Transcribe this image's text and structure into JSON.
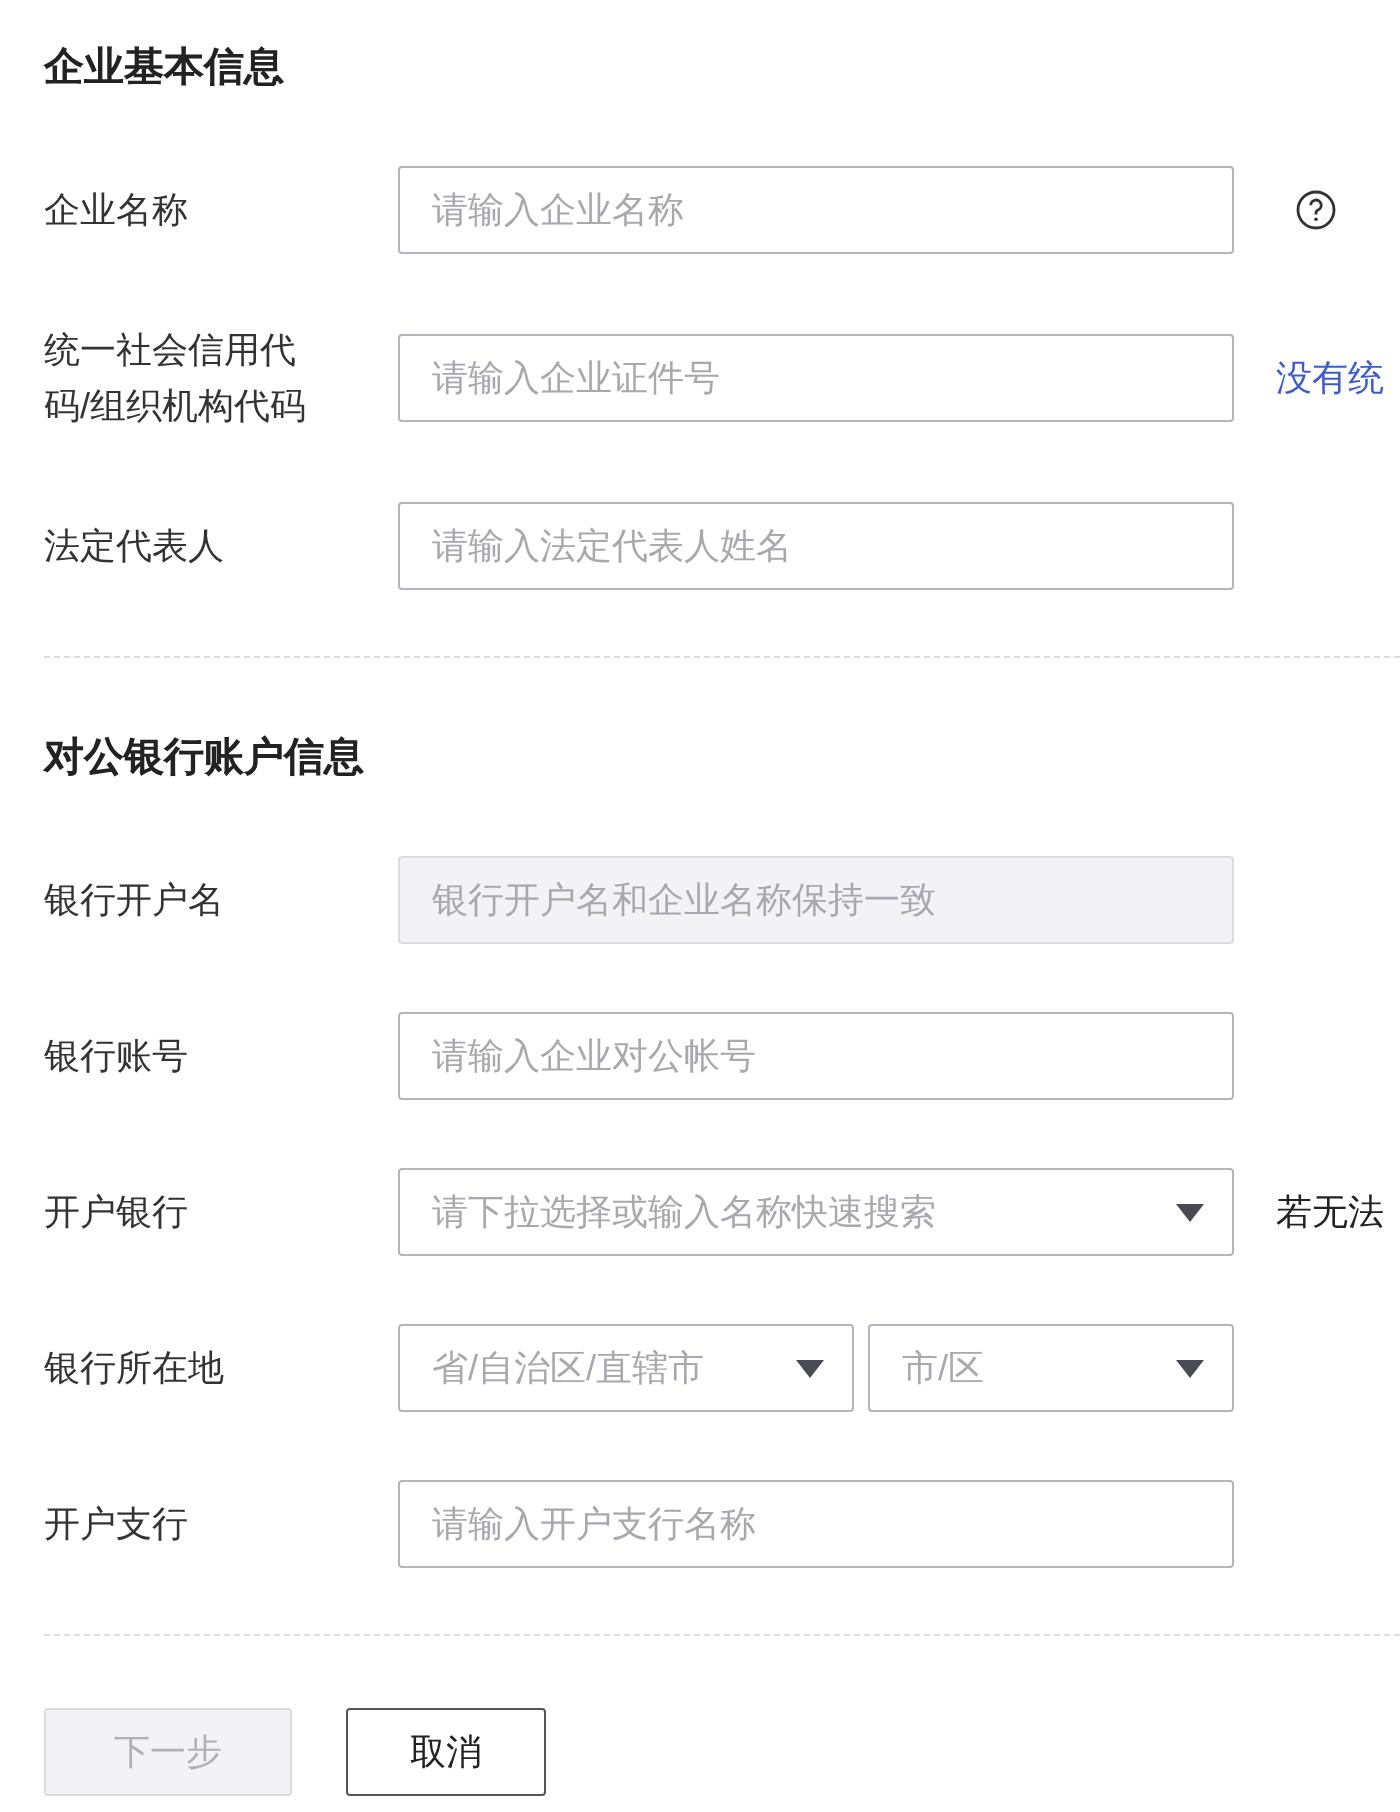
{
  "sections": [
    {
      "title": "企业基本信息",
      "fields": [
        {
          "label": "企业名称",
          "kind": "input",
          "placeholder": "请输入企业名称",
          "disabled": false,
          "aside": {
            "kind": "help"
          }
        },
        {
          "label": "统一社会信用代码/组织机构代码",
          "kind": "input",
          "placeholder": "请输入企业证件号",
          "disabled": false,
          "aside": {
            "kind": "link",
            "text": "没有统"
          }
        },
        {
          "label": "法定代表人",
          "kind": "input",
          "placeholder": "请输入法定代表人姓名",
          "disabled": false
        }
      ]
    },
    {
      "title": "对公银行账户信息",
      "fields": [
        {
          "label": "银行开户名",
          "kind": "input",
          "placeholder": "银行开户名和企业名称保持一致",
          "disabled": true
        },
        {
          "label": "银行账号",
          "kind": "input",
          "placeholder": "请输入企业对公帐号",
          "disabled": false
        },
        {
          "label": "开户银行",
          "kind": "select",
          "placeholder": "请下拉选择或输入名称快速搜索",
          "aside": {
            "kind": "note",
            "text": "若无法"
          }
        },
        {
          "label": "银行所在地",
          "kind": "select-pair",
          "placeholders": [
            "省/自治区/直辖市",
            "市/区"
          ]
        },
        {
          "label": "开户支行",
          "kind": "input",
          "placeholder": "请输入开户支行名称",
          "disabled": false
        }
      ]
    }
  ],
  "buttons": [
    {
      "label": "下一步",
      "disabled": true
    },
    {
      "label": "取消",
      "disabled": false
    }
  ]
}
